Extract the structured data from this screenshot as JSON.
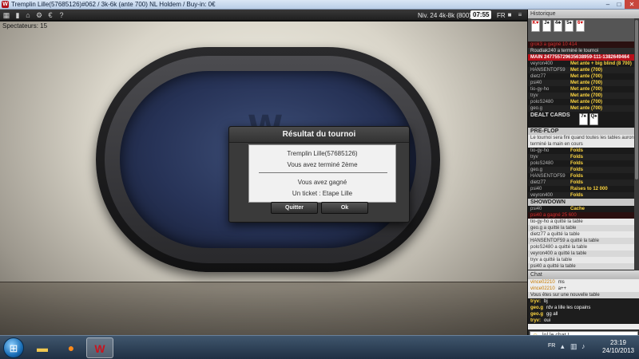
{
  "window": {
    "title": "Tremplin Lille(57685126)#062 / 3k-6k (ante 700) NL Holdem  / Buy-in: 0€",
    "controls": {
      "minimize": "–",
      "maximize": "□",
      "close": "✕"
    }
  },
  "toolbar": {
    "left_icons": [
      "lobby-icon",
      "stats-icon",
      "home-icon",
      "settings-icon",
      "currency-icon",
      "help-icon"
    ],
    "level": "Niv. 24  4k-8k (800)",
    "clock": "07:55",
    "language": "FR"
  },
  "game": {
    "spectators": "Spectateurs: 15",
    "felt_logo": "W"
  },
  "dialog": {
    "title": "Résultat du tournoi",
    "line1": "Tremplin Lille(57685126)",
    "line2": "Vous avez terminé 2ème",
    "line3": "Vous avez gagné",
    "line4": "Un ticket : Etape Lille",
    "quit_label": "Quitter",
    "ok_label": "Ok"
  },
  "history": {
    "header": "Historique",
    "board_cards": [
      "K♥",
      "J♠",
      "4♣",
      "5♠",
      "6♥"
    ],
    "top_red": "grok3 a gagné 10 414",
    "finished": "Roudiak240 a terminé le tournoi",
    "main": "MAIN 247755729635638959-111-1382649464",
    "antes": [
      {
        "who": "veyron400",
        "act": "Met ante + big blind (8 700)"
      },
      {
        "who": "HANSENTOF59",
        "act": "Met ante (700)"
      },
      {
        "who": "dietz77",
        "act": "Met ante (700)"
      },
      {
        "who": "psi40",
        "act": "Met ante (700)"
      },
      {
        "who": "tio-gy-ho",
        "act": "Met ante (700)"
      },
      {
        "who": "tryv",
        "act": "Met ante (700)"
      },
      {
        "who": "poloS2480",
        "act": "Met ante (700)"
      },
      {
        "who": "geo.g",
        "act": "Met ante (700)"
      }
    ],
    "dealt_label": "DEALT CARDS",
    "dealt_cards": [
      "7♠",
      "Q♠"
    ],
    "preflop_label": "PRE-FLOP",
    "preflop_info": "Le tournoi sera fini quand toutes les tables auront terminé la main en cours",
    "preflop_actions": [
      {
        "who": "tio-gy-ho",
        "act": "Folds"
      },
      {
        "who": "tryv",
        "act": "Folds"
      },
      {
        "who": "poloS2480",
        "act": "Folds"
      },
      {
        "who": "geo.g",
        "act": "Folds"
      },
      {
        "who": "HANSENTOF59",
        "act": "Folds"
      },
      {
        "who": "dietz77",
        "act": "Folds"
      },
      {
        "who": "psi40",
        "act": "Raises to 12 000"
      },
      {
        "who": "veyron400",
        "act": "Folds"
      }
    ],
    "showdown_label": "SHOWDOWN",
    "showdown_actions": [
      {
        "who": "psi40",
        "act": "Cache"
      }
    ],
    "showdown_red": "psi40 a gagné 25 600",
    "left_table": [
      "tio-gy-ho a quitté la table",
      "geo.g a quitté la table",
      "dietz77 a quitté la table",
      "HANSENTOF59 a quitté la table",
      "poloS2480 a quitté la table",
      "veyron400 a quitté la table",
      "tryv a quitté la table",
      "psi40 a quitté la table"
    ]
  },
  "chat": {
    "header": "Chat",
    "messages": [
      {
        "name": "vince02210",
        "text": "ms",
        "style": "light"
      },
      {
        "name": "vince02210",
        "text": "a++",
        "style": "light"
      },
      {
        "name": "",
        "text": "Vous êtes sur une nouvelle table",
        "style": "sys"
      },
      {
        "name": "tryv:",
        "text": "bj",
        "style": "dark"
      },
      {
        "name": "geo.g",
        "text": "rdv a lille les copains",
        "style": "dark"
      },
      {
        "name": "geo.g",
        "text": "gg all",
        "style": "dark"
      },
      {
        "name": "tryv:",
        "text": "oui",
        "style": "dark"
      }
    ],
    "input_value": "lol le chat !"
  },
  "taskbar": {
    "language": "FR",
    "time": "23:19",
    "date": "24/10/2013"
  }
}
